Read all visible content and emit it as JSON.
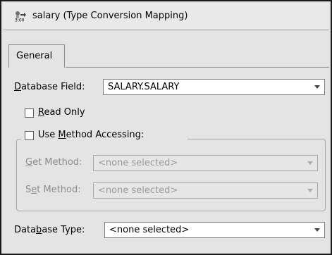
{
  "window": {
    "title": "salary (Type Conversion Mapping)",
    "icon": "type-conversion-mapping-icon"
  },
  "tabs": [
    {
      "label": "General",
      "selected": true
    }
  ],
  "database_field": {
    "label_prefix": "",
    "label_mnemonic": "D",
    "label_rest": "atabase Field:",
    "value": "SALARY.SALARY"
  },
  "read_only": {
    "label_mnemonic": "R",
    "label_rest": "ead Only",
    "checked": false
  },
  "method_accessing": {
    "label_prefix": "Use ",
    "label_mnemonic": "M",
    "label_rest": "ethod Accessing:",
    "checked": false,
    "get_method": {
      "label_prefix": "",
      "label_mnemonic": "G",
      "label_rest": "et Method:",
      "value": "<none selected>"
    },
    "set_method": {
      "label_prefix": "S",
      "label_mnemonic": "e",
      "label_rest": "t Method:",
      "value": "<none selected>"
    }
  },
  "database_type": {
    "label_prefix": "Data",
    "label_mnemonic": "b",
    "label_rest": "ase Type:",
    "value": "<none selected>"
  }
}
